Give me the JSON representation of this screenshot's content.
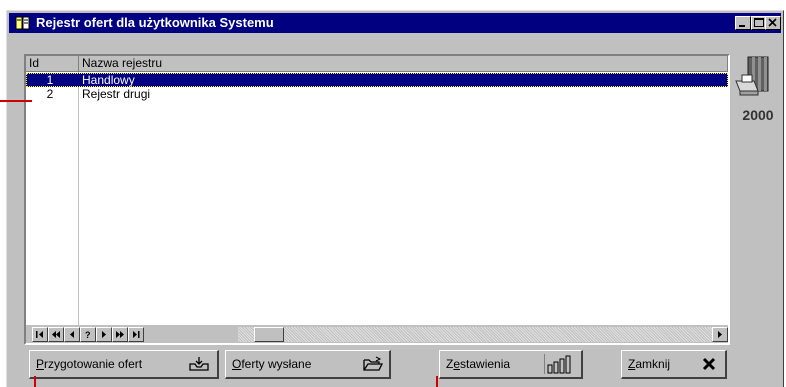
{
  "window": {
    "title": "Rejestr ofert dla użytkownika Systemu",
    "controls": [
      "minimize",
      "maximize",
      "close"
    ]
  },
  "grid": {
    "columns": [
      "Id",
      "Nazwa rejestru"
    ],
    "rows": [
      {
        "id": "1",
        "name": "Handlowy",
        "selected": true
      },
      {
        "id": "2",
        "name": "Rejestr drugi",
        "selected": false
      }
    ],
    "navigator": [
      "first",
      "prior-page",
      "prior",
      "?",
      "next",
      "next-page",
      "last"
    ]
  },
  "side": {
    "icon": "books-and-disk-icon",
    "label": "2000"
  },
  "buttons": {
    "przygotowanie": {
      "underline": "P",
      "rest": "rzygotowanie ofert",
      "icon": "inbox-tray-icon"
    },
    "wyslane": {
      "underline": "O",
      "rest": "ferty wysłane",
      "icon": "open-folder-icon"
    },
    "zestawienia": {
      "pre": "Z",
      "underline": "e",
      "rest": "stawienia",
      "icon": "bar-chart-icon"
    },
    "zamknij": {
      "underline": "Z",
      "rest": "amknij",
      "icon": "close-x-icon"
    }
  },
  "colors": {
    "titlebar": "#000080",
    "selection": "#000080",
    "face": "#c0c0c0",
    "annotation": "#cc0000"
  }
}
